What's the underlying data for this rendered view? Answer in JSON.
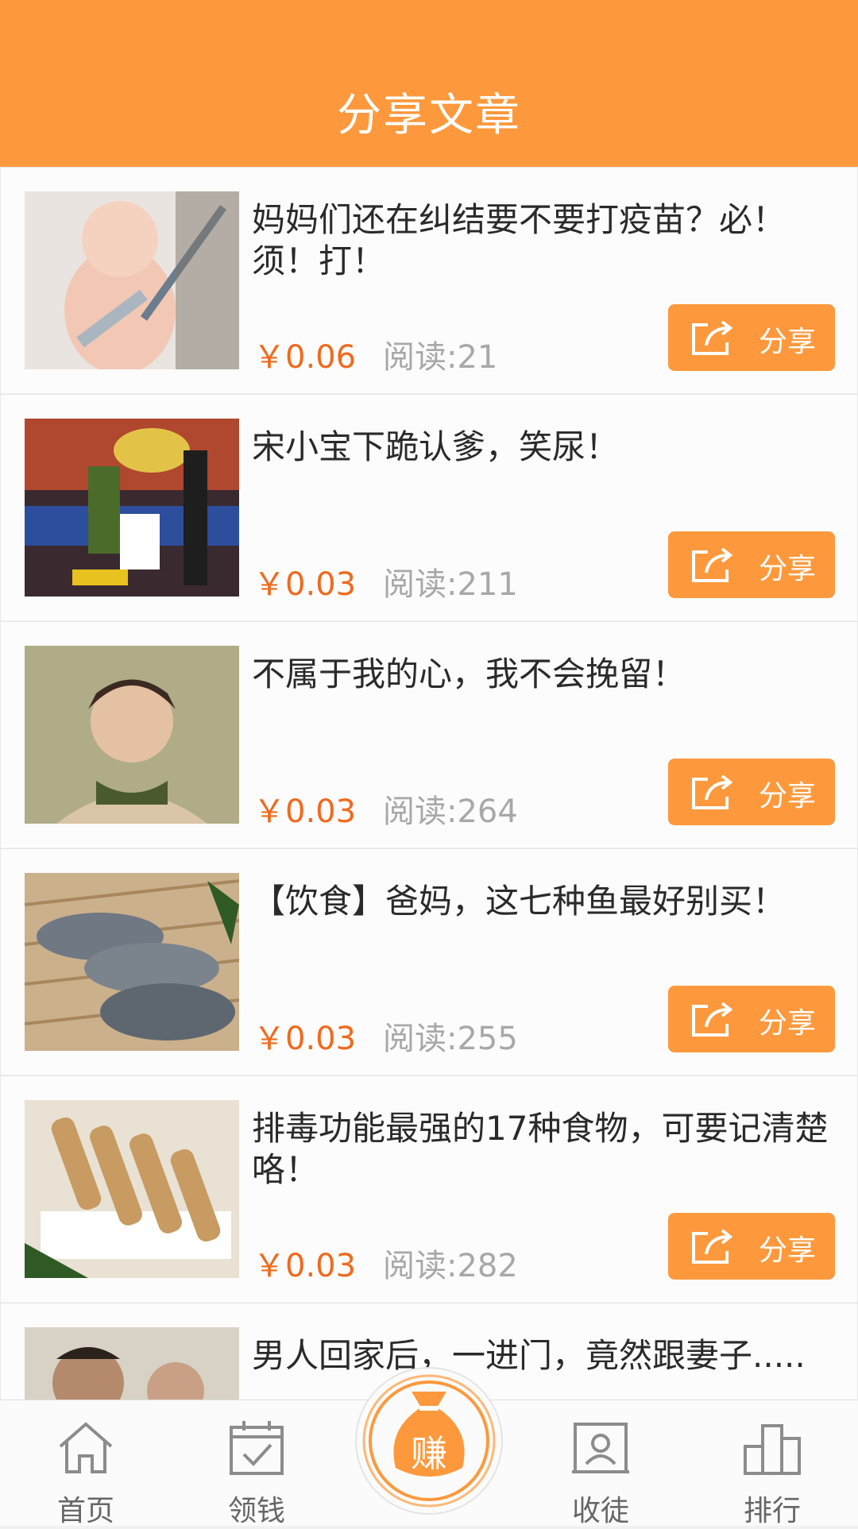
{
  "header": {
    "title": "分享文章"
  },
  "articles": [
    {
      "title": "妈妈们还在纠结要不要打疫苗？必！须！打！",
      "price": "￥0.06",
      "reads_label": "阅读:",
      "reads": "21",
      "share_label": "分享"
    },
    {
      "title": "宋小宝下跪认爹，笑尿！",
      "price": "￥0.03",
      "reads_label": "阅读:",
      "reads": "211",
      "share_label": "分享"
    },
    {
      "title": "不属于我的心，我不会挽留！",
      "price": "￥0.03",
      "reads_label": "阅读:",
      "reads": "264",
      "share_label": "分享"
    },
    {
      "title": "【饮食】爸妈，这七种鱼最好别买！",
      "price": "￥0.03",
      "reads_label": "阅读:",
      "reads": "255",
      "share_label": "分享"
    },
    {
      "title": "排毒功能最强的17种食物，可要记清楚咯！",
      "price": "￥0.03",
      "reads_label": "阅读:",
      "reads": "282",
      "share_label": "分享"
    },
    {
      "title": "男人回家后，一进门，竟然跟妻子.....",
      "price": "",
      "reads_label": "",
      "reads": "",
      "share_label": ""
    }
  ],
  "tabbar": {
    "home": "首页",
    "collect": "领钱",
    "earn": "赚",
    "recruit": "收徒",
    "rank": "排行"
  },
  "colors": {
    "accent": "#fd993c",
    "price": "#f06a1d",
    "muted": "#a8a8a8"
  }
}
